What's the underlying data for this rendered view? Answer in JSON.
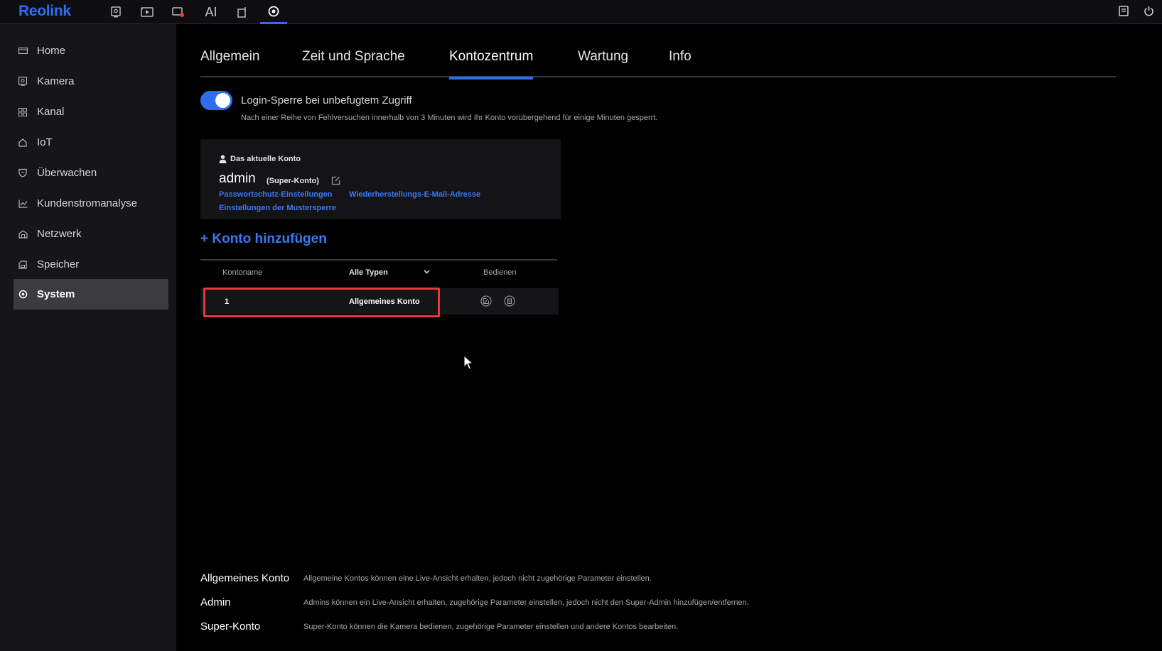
{
  "app": {
    "logo": "Reolink"
  },
  "topbar": {
    "icons": [
      "live-view-icon",
      "playback-icon",
      "alarm-icon",
      "ai-icon",
      "device-icon",
      "settings-icon"
    ],
    "ai_label": "AI",
    "right_icons": [
      "messages-icon",
      "power-icon"
    ]
  },
  "sidebar": {
    "items": [
      {
        "label": "Home",
        "icon": "home-icon"
      },
      {
        "label": "Kamera",
        "icon": "camera-icon"
      },
      {
        "label": "Kanal",
        "icon": "grid-icon"
      },
      {
        "label": "IoT",
        "icon": "iot-icon"
      },
      {
        "label": "Überwachen",
        "icon": "shield-icon"
      },
      {
        "label": "Kundenstromanalyse",
        "icon": "chart-icon"
      },
      {
        "label": "Netzwerk",
        "icon": "network-icon"
      },
      {
        "label": "Speicher",
        "icon": "storage-icon"
      },
      {
        "label": "System",
        "icon": "settings-icon",
        "active": true
      }
    ]
  },
  "tabs": [
    {
      "label": "Allgemein"
    },
    {
      "label": "Zeit und Sprache"
    },
    {
      "label": "Kontozentrum",
      "active": true
    },
    {
      "label": "Wartung"
    },
    {
      "label": "Info"
    }
  ],
  "login_lock": {
    "enabled": true,
    "title": "Login-Sperre bei unbefugtem Zugriff",
    "description": "Nach einer Reihe von Fehlversuchen innerhalb von 3 Minuten wird Ihr Konto vorübergehend für einige Minuten gesperrt."
  },
  "current_account": {
    "label": "Das aktuelle Konto",
    "name": "admin",
    "role": "(Super-Konto)",
    "links": {
      "password": "Passwortschutz-Einstellungen",
      "recovery_email": "Wiederherstellungs-E-Mail-Adresse",
      "pattern_lock": "Einstellungen der Mustersperre"
    }
  },
  "add_account_label": "+ Konto hinzufügen",
  "accounts_table": {
    "headers": {
      "name": "Kontoname",
      "type_filter": "Alle Typen",
      "actions": "Bedienen"
    },
    "rows": [
      {
        "name": "1",
        "type": "Allgemeines Konto"
      }
    ]
  },
  "legend": [
    {
      "term": "Allgemeines Konto",
      "description": "Allgemeine Kontos können eine Live-Ansicht erhalten, jedoch nicht zugehörige Parameter einstellen."
    },
    {
      "term": "Admin",
      "description": "Admins können ein Live-Ansicht erhalten, zugehörige Parameter einstellen, jedoch nicht den Super-Admin hinzufügen/entfernen."
    },
    {
      "term": "Super-Konto",
      "description": "Super-Konto können die Kamera bedienen, zugehörige Parameter einstellen und andere Kontos bearbeiten."
    }
  ],
  "colors": {
    "accent": "#2f6df0",
    "link": "#3a78f5",
    "highlight": "#e8383b",
    "background": "#000000",
    "sidebar": "#161618"
  }
}
